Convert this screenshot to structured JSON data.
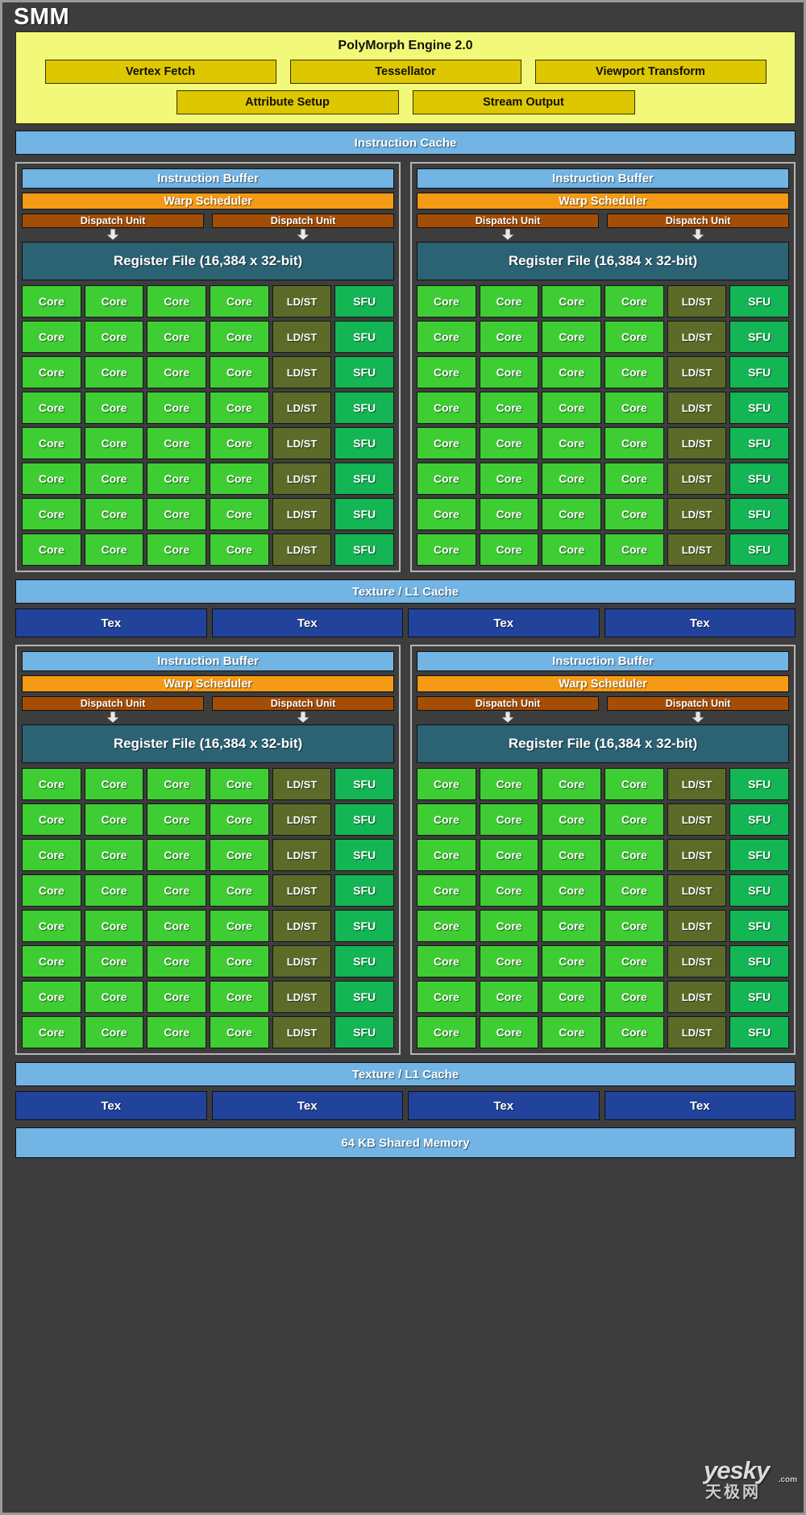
{
  "diagram": {
    "title": "SMM",
    "polymorph": {
      "title": "PolyMorph Engine 2.0",
      "top_row": [
        "Vertex Fetch",
        "Tessellator",
        "Viewport Transform"
      ],
      "bottom_row": [
        "Attribute Setup",
        "Stream Output"
      ]
    },
    "instruction_cache": "Instruction Cache",
    "processing_block": {
      "instruction_buffer": "Instruction Buffer",
      "warp_scheduler": "Warp Scheduler",
      "dispatch_units": [
        "Dispatch Unit",
        "Dispatch Unit"
      ],
      "register_file": "Register File (16,384 x 32-bit)",
      "core_row": [
        "Core",
        "Core",
        "Core",
        "Core",
        "LD/ST",
        "SFU"
      ],
      "core_row_count": 8,
      "cell_types": [
        "core",
        "core",
        "core",
        "core",
        "ldst",
        "sfu"
      ]
    },
    "texture_l1_cache": "Texture / L1 Cache",
    "tex_units": [
      "Tex",
      "Tex",
      "Tex",
      "Tex"
    ],
    "shared_memory": "64 KB Shared Memory",
    "watermark": {
      "latin": "yesky",
      "dotcom": ".com",
      "chinese": "天极网"
    },
    "colors": {
      "frame_background": "#3d3d3d",
      "frame_border": "#9a9a9a",
      "polymorph_fill": "#f2f878",
      "polymorph_box": "#ddc700",
      "cache_blue": "#72b4e4",
      "warp_orange": "#f59a15",
      "dispatch_brown": "#a44d05",
      "register_file_teal": "#2b6274",
      "core_green": "#3fcd34",
      "ldst_olive": "#5d6b29",
      "sfu_green": "#14b554",
      "tex_blue": "#21439b",
      "quadrant_border": "#b4b4b4"
    }
  }
}
